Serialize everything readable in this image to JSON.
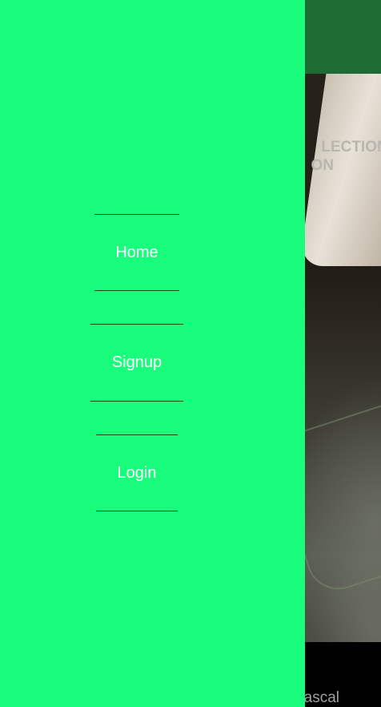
{
  "hero": {
    "title_line1": "LECTION,",
    "title_line2": "ON"
  },
  "footer": {
    "text": "ascal"
  },
  "nav": {
    "items": [
      {
        "label": "Home"
      },
      {
        "label": "Signup"
      },
      {
        "label": "Login"
      }
    ]
  },
  "colors": {
    "drawer_background": "#19fc7c",
    "header_background": "#1c6c34",
    "footer_background": "#000000",
    "nav_text": "#ffffff"
  }
}
